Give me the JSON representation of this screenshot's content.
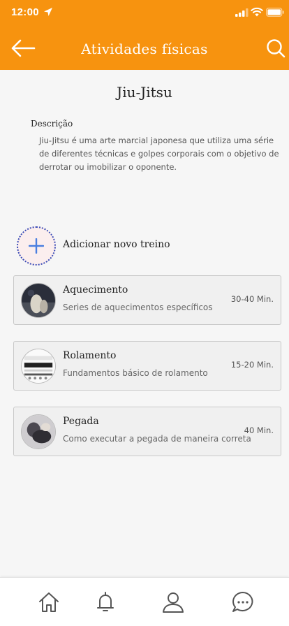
{
  "status_bar": {
    "time": "12:00"
  },
  "header": {
    "title": "Atividades físicas",
    "back_icon": "arrow-left-icon",
    "search_icon": "search-icon"
  },
  "activity": {
    "name": "Jiu-Jitsu",
    "description_label": "Descrição",
    "description": "Jiu-Jitsu é uma arte marcial japonesa que utiliza uma série de diferentes técnicas e golpes corporais com o objetivo de derrotar ou imobilizar o oponente."
  },
  "add_training": {
    "label": "Adicionar novo treino"
  },
  "trainings": [
    {
      "name": "Aquecimento",
      "description": "Series de aquecimentos específicos",
      "duration": "30-40 Min."
    },
    {
      "name": "Rolamento",
      "description": "Fundamentos básico de rolamento",
      "duration": "15-20 Min."
    },
    {
      "name": "Pegada",
      "description": "Como executar a pegada de maneira correta",
      "duration": "40 Min."
    }
  ],
  "tabbar": {
    "icons": [
      "home-icon",
      "bell-icon",
      "user-icon",
      "chat-icon"
    ]
  },
  "colors": {
    "primary": "#f7930f",
    "accent": "#3a4db8"
  }
}
